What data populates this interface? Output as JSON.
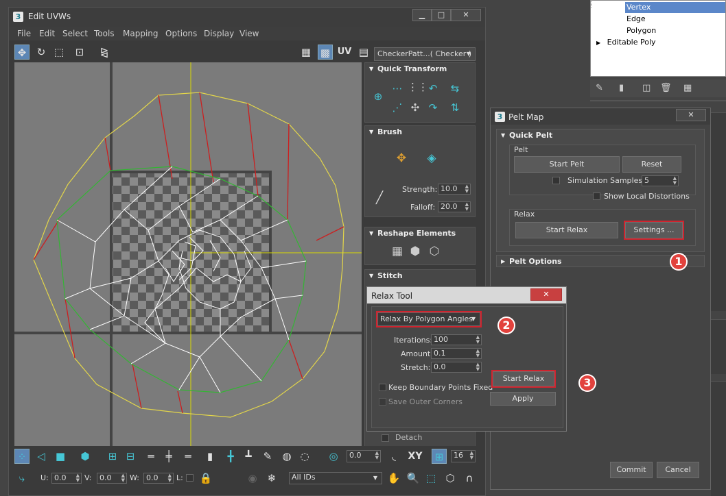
{
  "modifier_stack": {
    "items": [
      {
        "label": "Vertex",
        "selected": true
      },
      {
        "label": "Edge",
        "selected": false
      },
      {
        "label": "Polygon",
        "selected": false
      },
      {
        "label": "Editable Poly",
        "selected": false
      }
    ],
    "tool_icons": [
      "pin-icon",
      "show-end-result-icon",
      "make-unique-icon",
      "remove-modifier-icon",
      "configure-icon"
    ]
  },
  "uvw_window": {
    "app_badge": "3",
    "title": "Edit UVWs",
    "controls": {
      "minimize": "▁",
      "maximize": "□",
      "close": "✕"
    },
    "menu": [
      "File",
      "Edit",
      "Select",
      "Tools",
      "Mapping",
      "Options",
      "Display",
      "View"
    ],
    "uv_label": "UV",
    "texture_dropdown": "CheckerPatt...( Checker )",
    "rollouts": {
      "quick_transform": "Quick Transform",
      "brush": "Brush",
      "strength_label": "Strength:",
      "strength_value": "10.0",
      "falloff_label": "Falloff:",
      "falloff_value": "20.0",
      "reshape": "Reshape Elements",
      "stitch": "Stitch",
      "detach": "Detach"
    },
    "bottom1": {
      "angle_value": "0.0",
      "xy_label": "XY",
      "grid_value": "16"
    },
    "bottom2": {
      "u_label": "U:",
      "u_value": "0.0",
      "v_label": "V:",
      "v_value": "0.0",
      "w_label": "W:",
      "w_value": "0.0",
      "l_label": "L:",
      "ids_dropdown": "All IDs"
    }
  },
  "pelt_map": {
    "app_badge": "3",
    "title": "Pelt Map",
    "close": "✕",
    "quick_pelt": "Quick Pelt",
    "pelt_group": "Pelt",
    "start_pelt": "Start Pelt",
    "reset": "Reset",
    "sim_samples_label": "Simulation Samples:",
    "sim_samples_value": "5",
    "show_local_distortions": "Show Local Distortions",
    "relax_group": "Relax",
    "start_relax": "Start Relax",
    "settings": "Settings ...",
    "pelt_options": "Pelt Options",
    "commit": "Commit",
    "cancel": "Cancel"
  },
  "relax_tool": {
    "title": "Relax Tool",
    "close": "✕",
    "method": "Relax By Polygon Angles",
    "iterations_label": "Iterations:",
    "iterations_value": "100",
    "amount_label": "Amount:",
    "amount_value": "0.1",
    "stretch_label": "Stretch:",
    "stretch_value": "0.0",
    "keep_boundary": "Keep Boundary Points Fixed",
    "save_outer": "Save Outer Corners",
    "start_relax": "Start Relax",
    "apply": "Apply"
  },
  "callouts": [
    "1",
    "2",
    "3"
  ],
  "colors": {
    "highlight": "#d0232e",
    "callout": "#e2423d",
    "selection": "#5b87c9"
  }
}
